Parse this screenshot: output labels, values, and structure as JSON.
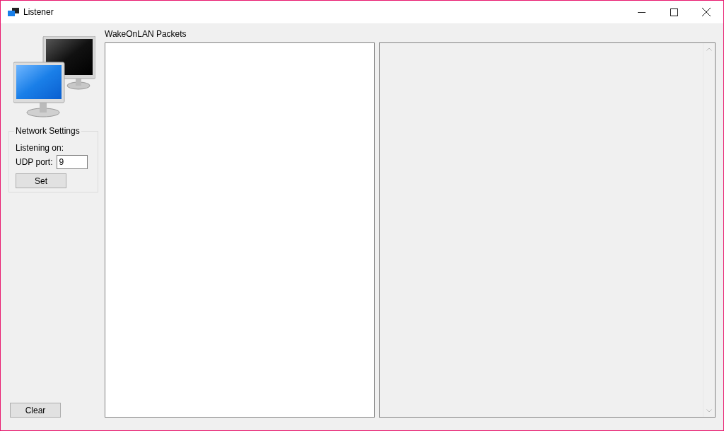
{
  "window": {
    "title": "Listener"
  },
  "network_settings": {
    "title": "Network Settings",
    "listening_label": "Listening on:",
    "port_label": "UDP port:",
    "port_value": "9",
    "set_button": "Set"
  },
  "clear_button": "Clear",
  "packets": {
    "label": "WakeOnLAN Packets"
  }
}
